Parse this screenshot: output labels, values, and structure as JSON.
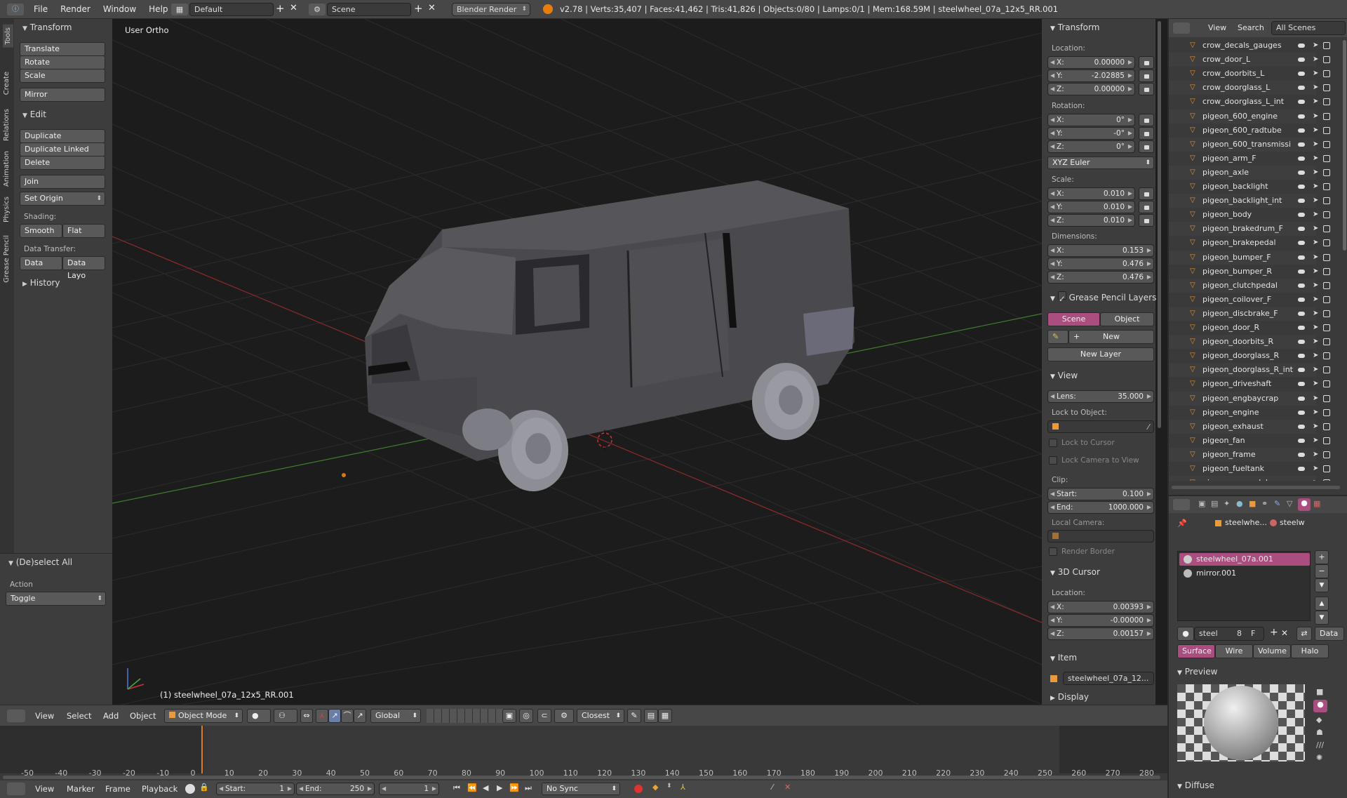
{
  "topbar": {
    "menus": [
      "File",
      "Render",
      "Window",
      "Help"
    ],
    "layout": "Default",
    "scene": "Scene",
    "engine": "Blender Render",
    "stats": "v2.78 | Verts:35,407 | Faces:41,462 | Tris:41,826 | Objects:0/80 | Lamps:0/1 | Mem:168.59M | steelwheel_07a_12x5_RR.001"
  },
  "vtabs": [
    "Tools",
    "Create",
    "Relations",
    "Animation",
    "Physics",
    "Grease Pencil"
  ],
  "tools": {
    "transform_header": "Transform",
    "translate": "Translate",
    "rotate": "Rotate",
    "scale": "Scale",
    "mirror": "Mirror",
    "edit_header": "Edit",
    "duplicate": "Duplicate",
    "duplicate_linked": "Duplicate Linked",
    "delete": "Delete",
    "join": "Join",
    "set_origin": "Set Origin",
    "shading_label": "Shading:",
    "smooth": "Smooth",
    "flat": "Flat",
    "data_transfer_label": "Data Transfer:",
    "data": "Data",
    "data_layo": "Data Layo",
    "history": "History",
    "deselect_header": "(De)select All",
    "action_label": "Action",
    "action_value": "Toggle"
  },
  "viewport": {
    "view_name": "User Ortho",
    "object_label": "(1) steelwheel_07a_12x5_RR.001"
  },
  "vp_header": {
    "view": "View",
    "select": "Select",
    "add": "Add",
    "object": "Object",
    "mode": "Object Mode",
    "orientation": "Global",
    "snap": "Closest"
  },
  "props": {
    "transform_header": "Transform",
    "location_label": "Location:",
    "loc_x": "0.00000",
    "loc_y": "-2.02885",
    "loc_z": "0.00000",
    "rotation_label": "Rotation:",
    "rot_x": "0°",
    "rot_y": "-0°",
    "rot_z": "0°",
    "euler": "XYZ Euler",
    "scale_label": "Scale:",
    "scl_x": "0.010",
    "scl_y": "0.010",
    "scl_z": "0.010",
    "dimensions_label": "Dimensions:",
    "dim_x": "0.153",
    "dim_y": "0.476",
    "dim_z": "0.476",
    "gp_header": "Grease Pencil Layers",
    "gp_scene": "Scene",
    "gp_object": "Object",
    "gp_new": "New",
    "gp_new_layer": "New Layer",
    "view_header": "View",
    "lens_label": "Lens:",
    "lens_value": "35.000",
    "lock_to_object": "Lock to Object:",
    "lock_to_cursor": "Lock to Cursor",
    "lock_camera": "Lock Camera to View",
    "clip_label": "Clip:",
    "clip_start_label": "Start:",
    "clip_start": "0.100",
    "clip_end_label": "End:",
    "clip_end": "1000.000",
    "local_camera": "Local Camera:",
    "render_border": "Render Border",
    "cursor_header": "3D Cursor",
    "cursor_location": "Location:",
    "cur_x": "0.00393",
    "cur_y": "-0.00000",
    "cur_z": "0.00157",
    "item_header": "Item",
    "item_name": "steelwheel_07a_12...",
    "display_header": "Display"
  },
  "outliner": {
    "view": "View",
    "search": "Search",
    "all_scenes": "All Scenes",
    "items": [
      "crow_decals_gauges",
      "crow_door_L",
      "crow_doorbits_L",
      "crow_doorglass_L",
      "crow_doorglass_L_int",
      "pigeon_600_engine",
      "pigeon_600_radtube",
      "pigeon_600_transmissi",
      "pigeon_arm_F",
      "pigeon_axle",
      "pigeon_backlight",
      "pigeon_backlight_int",
      "pigeon_body",
      "pigeon_brakedrum_F",
      "pigeon_brakepedal",
      "pigeon_bumper_F",
      "pigeon_bumper_R",
      "pigeon_clutchpedal",
      "pigeon_coilover_F",
      "pigeon_discbrake_F",
      "pigeon_door_R",
      "pigeon_doorbits_R",
      "pigeon_doorglass_R",
      "pigeon_doorglass_R_int",
      "pigeon_driveshaft",
      "pigeon_engbaycrap",
      "pigeon_engine",
      "pigeon_exhaust",
      "pigeon_fan",
      "pigeon_frame",
      "pigeon_fueltank",
      "pigeon_gaspedal"
    ]
  },
  "material": {
    "crumb1": "steelwhe...",
    "crumb2": "steelw",
    "slots": [
      "steelwheel_07a.001",
      "mirror.001"
    ],
    "mat_name": "steel",
    "users": "8",
    "f": "F",
    "data": "Data",
    "tabs": [
      "Surface",
      "Wire",
      "Volume",
      "Halo"
    ],
    "preview_header": "Preview",
    "diffuse_header": "Diffuse"
  },
  "timeline": {
    "ticks": [
      "-50",
      "-40",
      "-30",
      "-20",
      "-10",
      "0",
      "10",
      "20",
      "30",
      "40",
      "50",
      "60",
      "70",
      "80",
      "90",
      "100",
      "110",
      "120",
      "130",
      "140",
      "150",
      "160",
      "170",
      "180",
      "190",
      "200",
      "210",
      "220",
      "230",
      "240",
      "250",
      "260",
      "270",
      "280"
    ],
    "view": "View",
    "marker": "Marker",
    "frame": "Frame",
    "playback": "Playback",
    "start_label": "Start:",
    "start": "1",
    "end_label": "End:",
    "end": "250",
    "current": "1",
    "sync": "No Sync"
  },
  "colors": {
    "accent": "#a94e7f",
    "bg_viewport": "#1c1c1c",
    "panel": "#3c3c3c",
    "grid_x": "#8f2a2a",
    "grid_y": "#3f7d2c"
  }
}
